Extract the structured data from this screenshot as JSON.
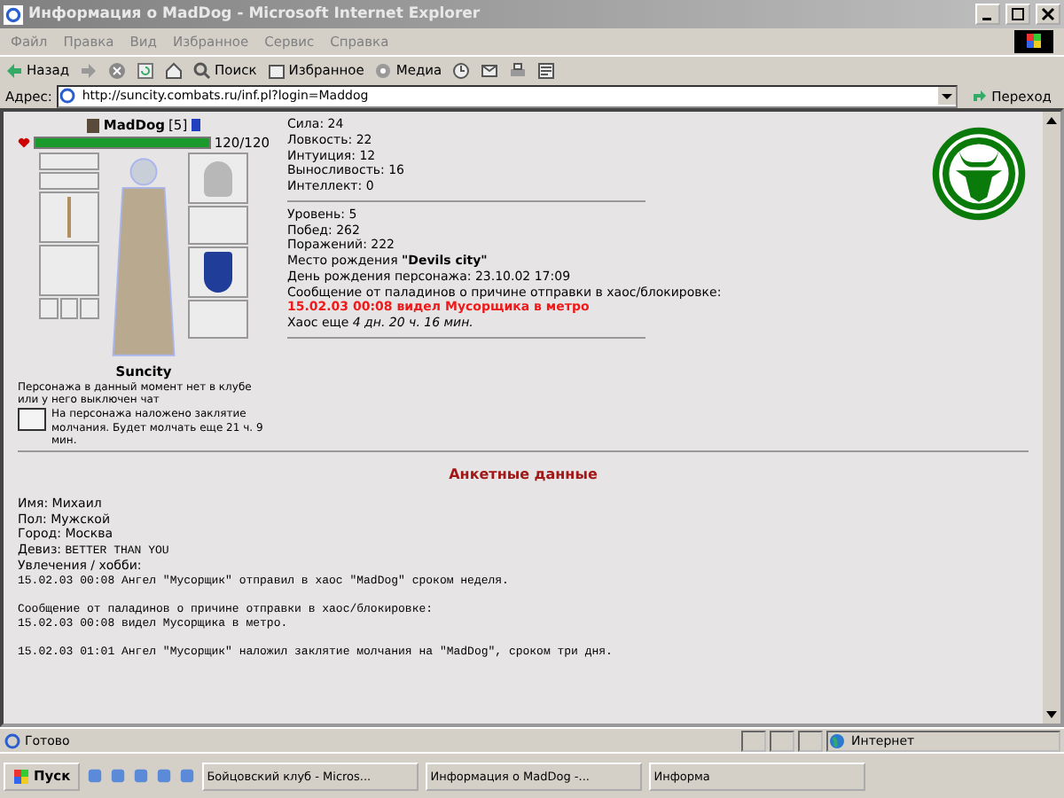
{
  "window": {
    "title": "Информация о MadDog - Microsoft Internet Explorer"
  },
  "menu": [
    "Файл",
    "Правка",
    "Вид",
    "Избранное",
    "Сервис",
    "Справка"
  ],
  "toolbar": {
    "back": "Назад",
    "search": "Поиск",
    "favorites": "Избранное",
    "media": "Медиа"
  },
  "address": {
    "label": "Адрес:",
    "value": "http://suncity.combats.ru/inf.pl?login=Maddog",
    "go": "Переход"
  },
  "character": {
    "name": "MadDog",
    "level": "[5]",
    "hp": {
      "level": 1.0,
      "reading": "120/120"
    },
    "city": "Suncity",
    "status": "Персонажа в данный момент нет в клубе или у него выключен чат",
    "silence": "На персонажа наложено заклятие молчания. Будет молчать еще 21 ч. 9 мин."
  },
  "stats": [
    "Сила: 24",
    "Ловкость: 22",
    "Интуиция: 12",
    "Выносливость: 16",
    "Интеллект: 0"
  ],
  "info": [
    {
      "kind": "plain",
      "text": "Уровень: 5"
    },
    {
      "kind": "plain",
      "text": "Побед: 262"
    },
    {
      "kind": "plain",
      "text": "Поражений: 222"
    },
    {
      "kind": "plain",
      "text": "Место рождения **\"Devils city\"**"
    },
    {
      "kind": "plain",
      "text": "День рождения персонажа: 23.10.02 17:09"
    },
    {
      "kind": "plain",
      "text": "Сообщение от паладинов о причине отправки в хаос/блокировке:"
    },
    {
      "kind": "alert",
      "text": "15.02.03 00:08 видел Мусорщика в метро"
    },
    {
      "kind": "plain",
      "text": "Хаос еще *4 дн. 20 ч. 16 мин.*"
    }
  ],
  "profile": {
    "heading": "Анкетные данные",
    "lines": [
      {
        "kind": "sans",
        "text": "Имя: Михаил"
      },
      {
        "kind": "sans",
        "text": "Пол: Мужской"
      },
      {
        "kind": "sans",
        "text": "Город: Москва"
      },
      {
        "kind": "motto",
        "label": "Девиз:",
        "value": "BETTER THAN YOU"
      },
      {
        "kind": "sans",
        "text": "Увлечения / хобби:"
      },
      {
        "kind": "mono",
        "text": "15.02.03 00:08  Ангел \"Мусорщик\" отправил в хаос \"MadDog\" сроком неделя."
      },
      {
        "kind": "gap"
      },
      {
        "kind": "mono",
        "text": "Сообщение от паладинов о причине отправки в хаос/блокировке:"
      },
      {
        "kind": "mono",
        "text": "15.02.03 00:08 видел Мусорщика в метро."
      },
      {
        "kind": "gap"
      },
      {
        "kind": "mono",
        "text": "15.02.03 01:01  Ангел \"Мусорщик\" наложил заклятие молчания на \"MadDog\", сроком три дня."
      }
    ]
  },
  "status_bar": {
    "text": "Готово",
    "zone": "Интернет"
  },
  "taskbar": {
    "start": "Пуск",
    "tasks": [
      "Бойцовский клуб - Micros...",
      "Информация о MadDog -...",
      "Информа"
    ]
  }
}
